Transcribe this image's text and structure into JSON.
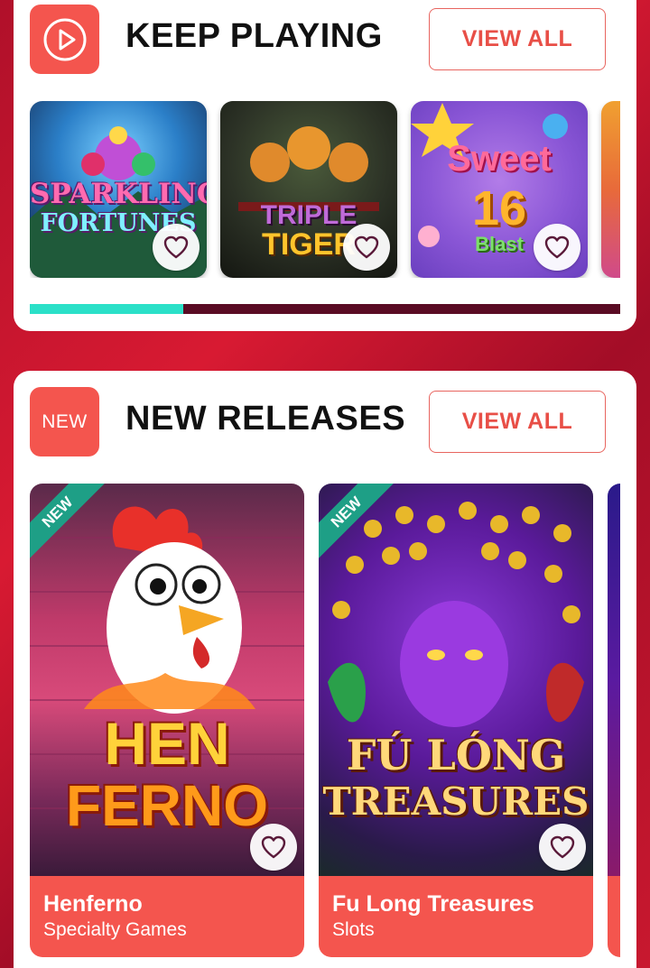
{
  "keep_playing": {
    "title": "KEEP PLAYING",
    "icon": "play-circle-icon",
    "view_all": "VIEW ALL",
    "scroll_progress": 0.26,
    "games": [
      {
        "art_line1": "SPARKLING",
        "art_line2": "FORTUNES"
      },
      {
        "art_line1": "TRIPLE",
        "art_line2": "TIGER"
      },
      {
        "art_line1": "Sweet",
        "art_line2": "16",
        "art_line3": "Blast"
      }
    ]
  },
  "new_releases": {
    "badge": "NEW",
    "title": "NEW RELEASES",
    "view_all": "VIEW ALL",
    "ribbon": "NEW",
    "games": [
      {
        "name": "Henferno",
        "category": "Specialty Games",
        "art_line1": "HEN",
        "art_line2": "FERNO"
      },
      {
        "name": "Fu Long Treasures",
        "category": "Slots",
        "art_line1": "FÚ LÓNG",
        "art_line2": "TREASURES"
      }
    ]
  },
  "colors": {
    "accent": "#f4554e",
    "scroll_thumb": "#2be0c8",
    "scroll_track": "#5a0c24",
    "ribbon": "#1e9f86",
    "background": "#c8182f"
  }
}
